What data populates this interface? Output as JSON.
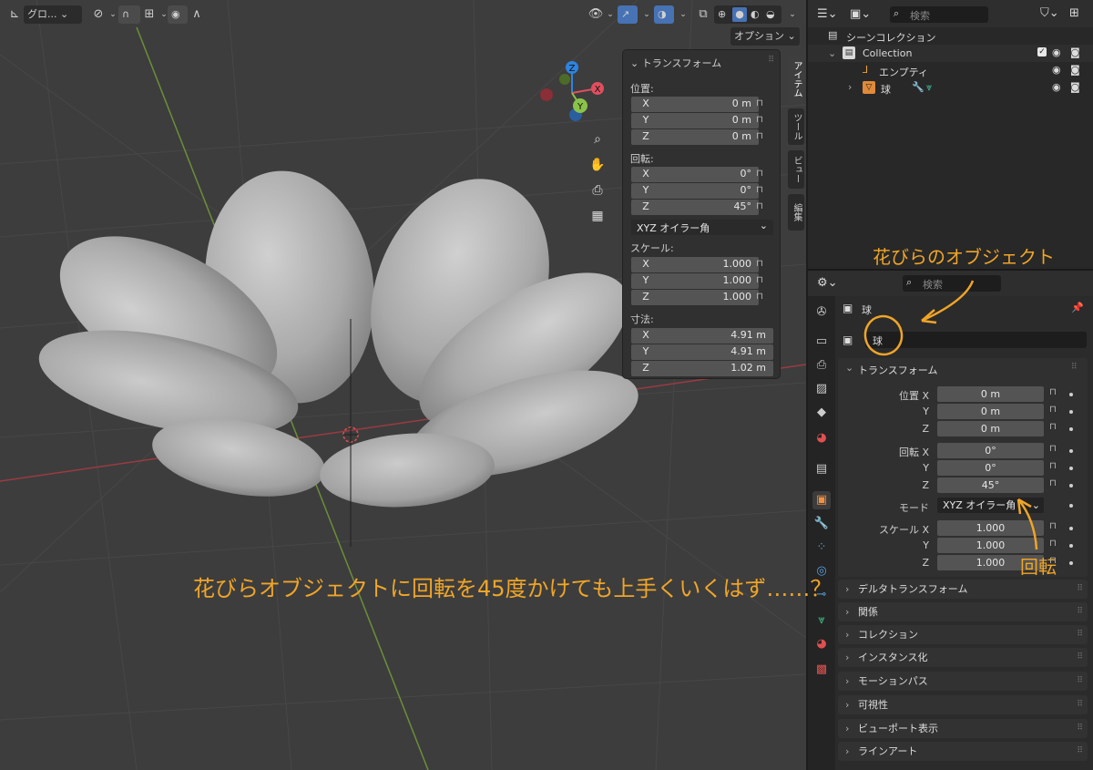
{
  "viewport": {
    "header": {
      "orientation_label": "グロ...",
      "options_label": "オプション"
    },
    "npanel": {
      "panel_title": "トランスフォーム",
      "location_label": "位置:",
      "location": [
        {
          "axis": "X",
          "value": "0 m"
        },
        {
          "axis": "Y",
          "value": "0 m"
        },
        {
          "axis": "Z",
          "value": "0 m"
        }
      ],
      "rotation_label": "回転:",
      "rotation": [
        {
          "axis": "X",
          "value": "0°"
        },
        {
          "axis": "Y",
          "value": "0°"
        },
        {
          "axis": "Z",
          "value": "45°"
        }
      ],
      "rotation_mode": "XYZ オイラー角",
      "scale_label": "スケール:",
      "scale": [
        {
          "axis": "X",
          "value": "1.000"
        },
        {
          "axis": "Y",
          "value": "1.000"
        },
        {
          "axis": "Z",
          "value": "1.000"
        }
      ],
      "dimensions_label": "寸法:",
      "dimensions": [
        {
          "axis": "X",
          "value": "4.91 m"
        },
        {
          "axis": "Y",
          "value": "4.91 m"
        },
        {
          "axis": "Z",
          "value": "1.02 m"
        }
      ]
    },
    "side_tabs": [
      "アイテム",
      "ツール",
      "ビュー",
      "編集"
    ],
    "gizmo_labels": {
      "x": "X",
      "y": "Y",
      "z": "Z"
    }
  },
  "outliner": {
    "search_placeholder": "検索",
    "scene_collection": "シーンコレクション",
    "items": [
      {
        "label": "Collection"
      },
      {
        "label": "エンプティ"
      },
      {
        "label": "球"
      }
    ]
  },
  "properties": {
    "search_placeholder": "検索",
    "object_name_header": "球",
    "object_name_field": "球",
    "transform_title": "トランスフォーム",
    "location_label": "位置",
    "rotation_label": "回転",
    "scale_label": "スケール",
    "mode_label": "モード",
    "mode_value": "XYZ オイラー角",
    "location": [
      {
        "axis": "X",
        "value": "0 m"
      },
      {
        "axis": "Y",
        "value": "0 m"
      },
      {
        "axis": "Z",
        "value": "0 m"
      }
    ],
    "rotation": [
      {
        "axis": "X",
        "value": "0°"
      },
      {
        "axis": "Y",
        "value": "0°"
      },
      {
        "axis": "Z",
        "value": "45°"
      }
    ],
    "scale": [
      {
        "axis": "X",
        "value": "1.000"
      },
      {
        "axis": "Y",
        "value": "1.000"
      },
      {
        "axis": "Z",
        "value": "1.000"
      }
    ],
    "subpanels": [
      "デルタトランスフォーム",
      "関係",
      "コレクション",
      "インスタンス化",
      "モーションパス",
      "可視性",
      "ビューポート表示",
      "ラインアート"
    ]
  },
  "annotations": {
    "petal_object": "花びらのオブジェクト",
    "rotation_note": "回転",
    "caption": "花びらオブジェクトに回転を45度かけても上手くいくはず……？"
  },
  "colors": {
    "annotation": "#f0a528",
    "accent_blue": "#4772b3",
    "x_axis": "#e04f5f",
    "y_axis": "#8bc34a",
    "z_axis": "#2f83e0"
  }
}
